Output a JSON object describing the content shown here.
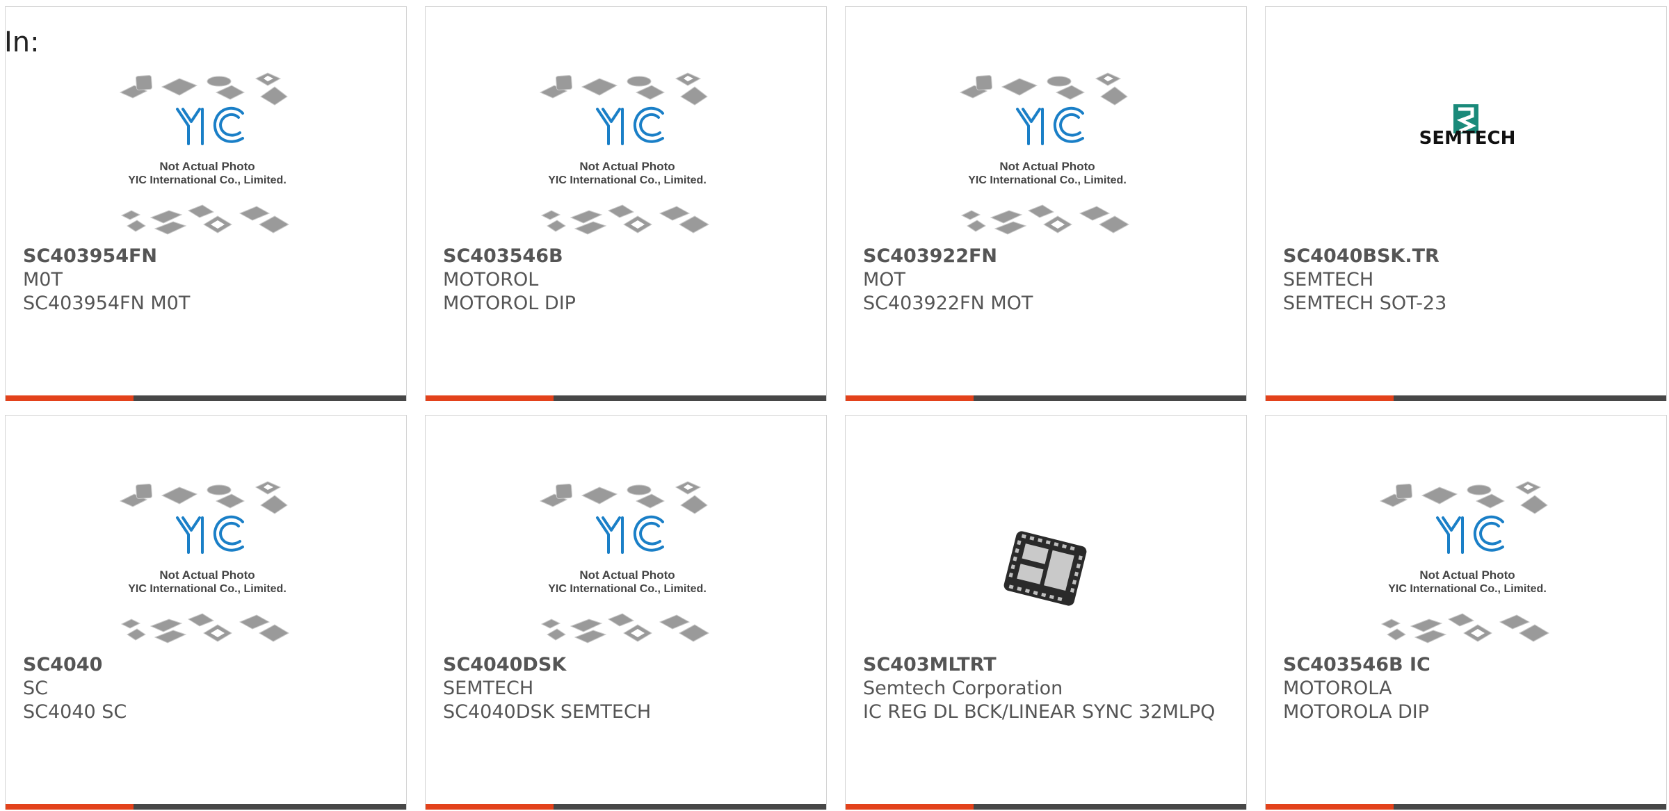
{
  "header": {
    "label": "In:"
  },
  "products": [
    {
      "part": "SC403954FN",
      "manufacturer": "M0T",
      "description": "SC403954FN M0T",
      "image": "placeholder"
    },
    {
      "part": "SC403546B",
      "manufacturer": "MOTOROL",
      "description": "MOTOROL DIP",
      "image": "placeholder"
    },
    {
      "part": "SC403922FN",
      "manufacturer": "MOT",
      "description": "SC403922FN MOT",
      "image": "placeholder"
    },
    {
      "part": "SC4040BSK.TR",
      "manufacturer": "SEMTECH",
      "description": "SEMTECH SOT-23",
      "image": "semtech-logo"
    },
    {
      "part": "SC4040",
      "manufacturer": "SC",
      "description": "SC4040 SC",
      "image": "placeholder"
    },
    {
      "part": "SC4040DSK",
      "manufacturer": "SEMTECH",
      "description": "SC4040DSK SEMTECH",
      "image": "placeholder"
    },
    {
      "part": "SC403MLTRT",
      "manufacturer": "Semtech Corporation",
      "description": "IC REG DL BCK/LINEAR SYNC 32MLPQ",
      "image": "chip-photo"
    },
    {
      "part": "SC403546B IC",
      "manufacturer": "MOTOROLA",
      "description": "MOTOROLA DIP",
      "image": "placeholder"
    }
  ],
  "placeholder": {
    "brand": "YIC",
    "line1": "Not Actual Photo",
    "line2": "YIC International Co., Limited."
  },
  "semtech": {
    "brand": "SEMTECH"
  },
  "colors": {
    "accent": "#e3421b",
    "bar_dark": "#474747",
    "yic_blue": "#1a7fc7",
    "text": "#555555",
    "border": "#d4d4d4"
  }
}
